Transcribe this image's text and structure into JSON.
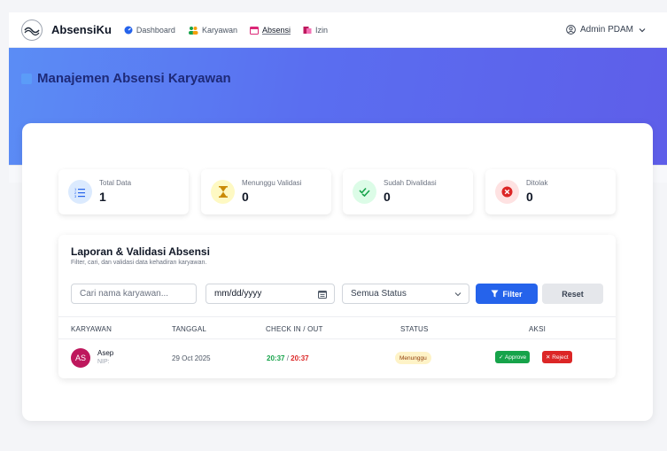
{
  "app": {
    "name": "AbsensiKu"
  },
  "nav": {
    "items": [
      {
        "label": "Dashboard",
        "icon": "dashboard-icon"
      },
      {
        "label": "Karyawan",
        "icon": "users-icon"
      },
      {
        "label": "Absensi",
        "icon": "calendar-icon"
      },
      {
        "label": "Izin",
        "icon": "folder-icon"
      }
    ],
    "active": "Absensi"
  },
  "user": {
    "name": "Admin PDAM"
  },
  "page": {
    "title": "Manajemen Absensi Karyawan"
  },
  "stats": [
    {
      "label": "Total Data",
      "value": "1",
      "icon": "list-icon",
      "color": "#2563eb"
    },
    {
      "label": "Menunggu Validasi",
      "value": "0",
      "icon": "hourglass-icon",
      "color": "#ca8a04"
    },
    {
      "label": "Sudah Divalidasi",
      "value": "0",
      "icon": "check-double-icon",
      "color": "#16a34a"
    },
    {
      "label": "Ditolak",
      "value": "0",
      "icon": "x-circle-icon",
      "color": "#dc2626"
    }
  ],
  "report": {
    "title": "Laporan & Validasi Absensi",
    "subtitle": "Filter, cari, dan validasi data kehadiran karyawan.",
    "search_placeholder": "Cari nama karyawan...",
    "date_placeholder": "mm/dd/yyyy",
    "status_select": "Semua Status",
    "filter_label": "Filter",
    "reset_label": "Reset"
  },
  "table": {
    "columns": [
      "KARYAWAN",
      "TANGGAL",
      "CHECK IN / OUT",
      "STATUS",
      "AKSI"
    ],
    "rows": [
      {
        "initials": "AS",
        "name": "Asep",
        "nip": "NIP:",
        "date": "29 Oct 2025",
        "check_in": "20:37",
        "separator": " / ",
        "check_out": "20:37",
        "status": "Menunggu",
        "approve_label": "✓ Approve",
        "reject_label": "✕ Reject"
      }
    ]
  },
  "colors": {
    "accent": "#2563eb",
    "hero_start": "#5b8df5",
    "hero_end": "#5e5ee9",
    "approve": "#16a34a",
    "reject": "#dc2626"
  }
}
